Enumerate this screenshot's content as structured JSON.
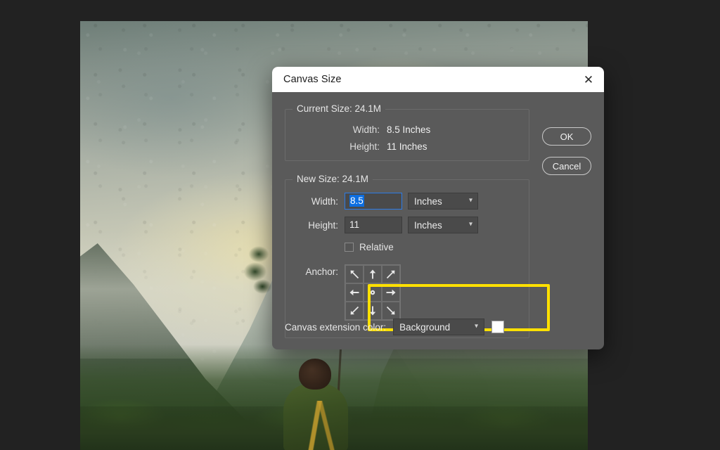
{
  "dialog": {
    "title": "Canvas Size",
    "close_icon": "close-icon",
    "buttons": {
      "ok": "OK",
      "cancel": "Cancel"
    },
    "current_size": {
      "legend": "Current Size: 24.1M",
      "rows": [
        {
          "label": "Width:",
          "value": "8.5 Inches"
        },
        {
          "label": "Height:",
          "value": "11 Inches"
        }
      ]
    },
    "new_size": {
      "legend": "New Size: 24.1M",
      "width": {
        "label": "Width:",
        "value": "8.5",
        "selected": true,
        "unit": "Inches",
        "unit_chevron": "chevron-down-icon"
      },
      "height": {
        "label": "Height:",
        "value": "11",
        "selected": false,
        "unit": "Inches",
        "unit_chevron": "chevron-down-icon"
      },
      "relative": {
        "label": "Relative",
        "checked": false
      },
      "anchor": {
        "label": "Anchor:",
        "cells": [
          "arrow-up-left",
          "arrow-up",
          "arrow-up-right",
          "arrow-left",
          "center-dot",
          "arrow-right",
          "arrow-down-left",
          "arrow-down",
          "arrow-down-right"
        ]
      }
    },
    "canvas_extension": {
      "label": "Canvas extension color:",
      "value": "Background",
      "chevron": "chevron-down-icon",
      "swatch_color": "#ffffff"
    }
  },
  "colors": {
    "dialog_body": "#5a5a5a",
    "titlebar": "#ffffff",
    "highlight": "#ffe000",
    "selection": "#0d6ee0",
    "app_background": "#222222"
  },
  "canvas": {
    "artwork_description": "Landscape painting: misty mountains with a cloaked figure"
  }
}
